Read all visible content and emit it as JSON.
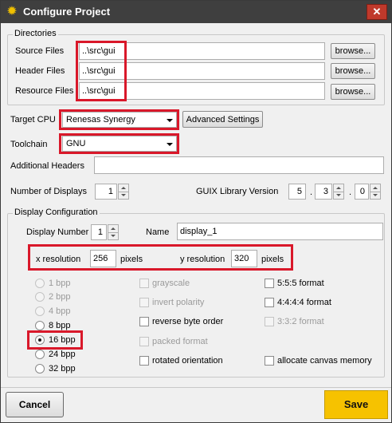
{
  "window": {
    "title": "Configure Project",
    "close": "✕"
  },
  "directories": {
    "title": "Directories",
    "rows": [
      {
        "label": "Source Files",
        "value": "..\\src\\gui",
        "button": "browse..."
      },
      {
        "label": "Header Files",
        "value": "..\\src\\gui",
        "button": "browse..."
      },
      {
        "label": "Resource Files",
        "value": "..\\src\\gui",
        "button": "browse..."
      }
    ]
  },
  "target_cpu": {
    "label": "Target CPU",
    "value": "Renesas Synergy",
    "button": "Advanced Settings"
  },
  "toolchain": {
    "label": "Toolchain",
    "value": "GNU"
  },
  "additional_headers": {
    "label": "Additional Headers",
    "value": ""
  },
  "number_of_displays": {
    "label": "Number of Displays",
    "value": "1"
  },
  "guix_version": {
    "label": "GUIX Library Version",
    "major": "5",
    "minor": "3",
    "patch": "0"
  },
  "display_config": {
    "title": "Display Configuration",
    "display_number_label": "Display Number",
    "display_number": "1",
    "name_label": "Name",
    "name": "display_1",
    "x_res_label": "x resolution",
    "x_res": "256",
    "y_res_label": "y resolution",
    "y_res": "320",
    "pixels_label": "pixels",
    "formats": [
      {
        "label": "1 bpp",
        "enabled": false,
        "selected": false
      },
      {
        "label": "2 bpp",
        "enabled": false,
        "selected": false
      },
      {
        "label": "4 bpp",
        "enabled": false,
        "selected": false
      },
      {
        "label": "8 bpp",
        "enabled": true,
        "selected": false
      },
      {
        "label": "16 bpp",
        "enabled": true,
        "selected": true
      },
      {
        "label": "24 bpp",
        "enabled": true,
        "selected": false
      },
      {
        "label": "32 bpp",
        "enabled": true,
        "selected": false
      }
    ],
    "options_left": [
      {
        "label": "grayscale",
        "enabled": false,
        "checked": false
      },
      {
        "label": "invert polarity",
        "enabled": false,
        "checked": false
      },
      {
        "label": "reverse byte order",
        "enabled": true,
        "checked": false
      },
      {
        "label": "packed format",
        "enabled": false,
        "checked": false
      },
      {
        "label": "rotated orientation",
        "enabled": true,
        "checked": false
      }
    ],
    "options_right": [
      {
        "label": "5:5:5 format",
        "enabled": true,
        "checked": false
      },
      {
        "label": "4:4:4:4 format",
        "enabled": true,
        "checked": false
      },
      {
        "label": "3:3:2 format",
        "enabled": false,
        "checked": false
      },
      {
        "label": "allocate canvas memory",
        "enabled": true,
        "checked": false
      }
    ]
  },
  "buttons": {
    "cancel": "Cancel",
    "save": "Save"
  },
  "colors": {
    "highlight": "#d9182a",
    "save": "#f6c200",
    "titlebar": "#3f3f3f"
  }
}
